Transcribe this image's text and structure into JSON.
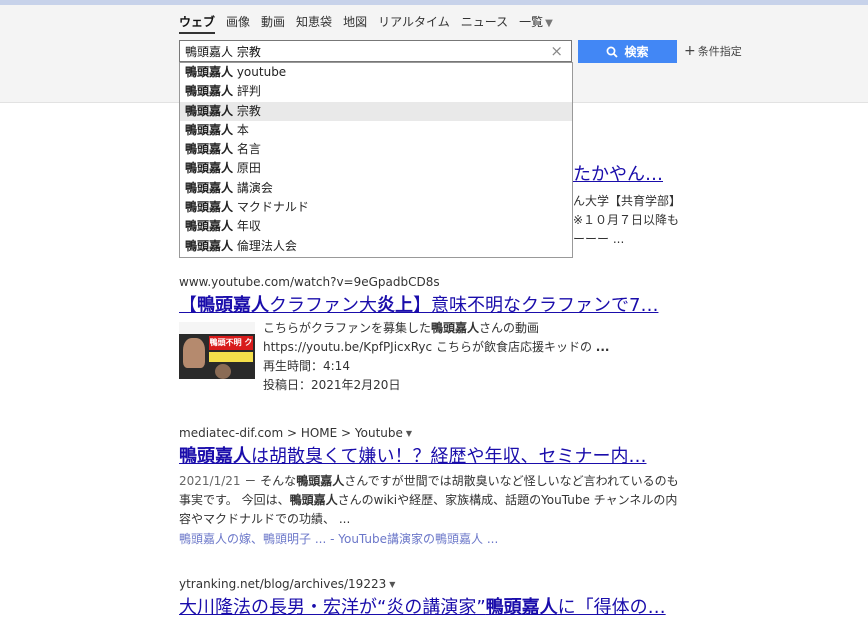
{
  "tabs": [
    {
      "label": "ウェブ",
      "active": true
    },
    {
      "label": "画像"
    },
    {
      "label": "動画"
    },
    {
      "label": "知恵袋"
    },
    {
      "label": "地図"
    },
    {
      "label": "リアルタイム"
    },
    {
      "label": "ニュース"
    },
    {
      "label": "一覧",
      "caret": "▼"
    }
  ],
  "search": {
    "value": "鴨頭嘉人 宗教",
    "button_label": "検索",
    "clear_glyph": "×",
    "conditions_label": "条件指定",
    "plus_glyph": "+"
  },
  "suggestions": [
    {
      "bold": "鴨頭嘉人",
      "rest": " youtube"
    },
    {
      "bold": "鴨頭嘉人",
      "rest": " 評判"
    },
    {
      "bold": "鴨頭嘉人",
      "rest": " 宗教",
      "selected": true
    },
    {
      "bold": "鴨頭嘉人",
      "rest": " 本"
    },
    {
      "bold": "鴨頭嘉人",
      "rest": " 名言"
    },
    {
      "bold": "鴨頭嘉人",
      "rest": " 原田"
    },
    {
      "bold": "鴨頭嘉人",
      "rest": " 講演会"
    },
    {
      "bold": "鴨頭嘉人",
      "rest": " マクドナルド"
    },
    {
      "bold": "鴨頭嘉人",
      "rest": " 年収"
    },
    {
      "bold": "鴨頭嘉人",
      "rest": " 倫理法人会"
    }
  ],
  "result0_partial": {
    "title_tail": "たかやん…",
    "line1": "ん大学【共育学部】",
    "line2": "※１０月７日以降も",
    "line3": "ーーー ..."
  },
  "result1": {
    "url": "www.youtube.com/watch?v=9eGpadbCD8s",
    "title_pre": "【",
    "title_b1": "鴨頭嘉人",
    "title_mid": "クラファン大",
    "title_b2": "炎上",
    "title_post": "】意味不明なクラファンで7…",
    "thumb_caption": "鴨頭不明 クラファン",
    "desc1_pre": "こちらがクラファンを募集した",
    "desc1_b": "鴨頭嘉人",
    "desc1_post": "さんの動画https://youtu.be/KpfPJicxRyc こちらが飲食店応援キッドの ",
    "desc1_ellipsis": "...",
    "duration": "再生時間：4:14",
    "posted": "投稿日：2021年2月20日"
  },
  "result2": {
    "url": "mediatec-dif.com > HOME > Youtube",
    "url_tri": "▼",
    "title_b": "鴨頭嘉人",
    "title_post": "は胡散臭くて嫌い！？経歴や年収、セミナー内…",
    "date": "2021/1/21",
    "sep": " － ",
    "s1": "そんな",
    "s1b": "鴨頭嘉人",
    "s2": "さんですが世間では胡散臭いなど怪しいなど言われているのも事実です。 今回は、",
    "s2b": "鴨頭嘉人",
    "s3": "さんのwikiや経歴、家族構成、話題のYouTube チャンネルの内容やマクドナルドでの功績、 ...",
    "sublink1": "鴨頭嘉人の嫁、鴨頭明子 ...",
    "sublink_sep": " - ",
    "sublink2": "YouTube講演家の鴨頭嘉人 ..."
  },
  "result3": {
    "url": "ytranking.net/blog/archives/19223",
    "url_tri": "▼",
    "title_pre": "大川隆法の長男・宏洋が“炎の講演家”",
    "title_b": "鴨頭嘉人",
    "title_post": "に「得体の…"
  },
  "colors": {
    "link": "#1a0dab",
    "search_button": "#4287f5",
    "sublink": "#6b77c9"
  }
}
